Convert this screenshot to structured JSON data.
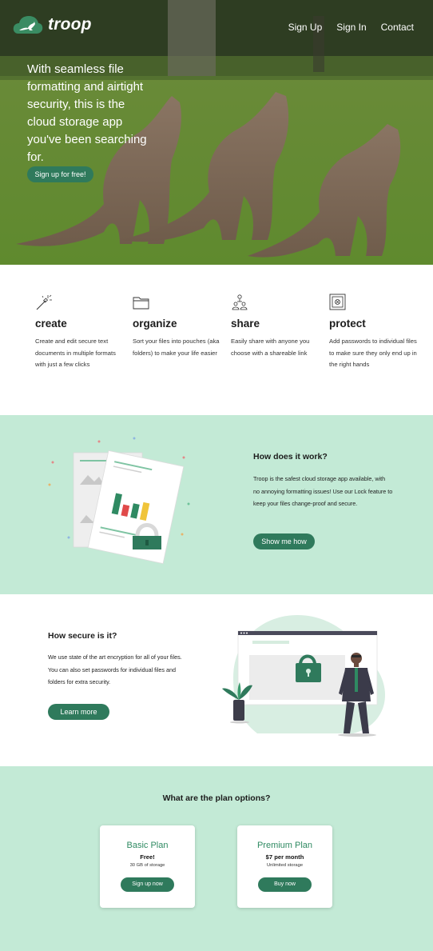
{
  "brand": {
    "name": "troop",
    "accent": "#2f7a5c",
    "mint": "#c3ead6"
  },
  "nav": [
    {
      "label": "Sign Up"
    },
    {
      "label": "Sign In"
    },
    {
      "label": "Contact"
    }
  ],
  "hero": {
    "headline": "With seamless file formatting and airtight security, this is the cloud storage app you've been searching for.",
    "cta": "Sign up for free!"
  },
  "features": [
    {
      "icon": "magic-wand-icon",
      "title": "create",
      "text": "Create and edit secure text documents in multiple formats with just a few clicks"
    },
    {
      "icon": "folder-icon",
      "title": "organize",
      "text": "Sort your files into pouches (aka folders) to make your life easier"
    },
    {
      "icon": "people-share-icon",
      "title": "share",
      "text": "Easily share with anyone you choose with a shareable link"
    },
    {
      "icon": "safe-icon",
      "title": "protect",
      "text": "Add passwords to individual files to make sure they only end up in the right hands"
    }
  ],
  "how": {
    "title": "How does it work?",
    "text": "Troop is the safest cloud storage app available, with no annoying formatting issues! Use our Lock feature to keep your files change-proof and secure.",
    "cta": "Show me how"
  },
  "secure": {
    "title": "How secure is it?",
    "text": "We use state of the art encryption for all of your files. You can also set passwords for individual files and folders for extra security.",
    "cta": "Learn more"
  },
  "plans": {
    "title": "What are the plan options?",
    "items": [
      {
        "name": "Basic Plan",
        "price": "Free!",
        "storage": "30 GB of storage",
        "cta": "Sign up now"
      },
      {
        "name": "Premium Plan",
        "price": "$7 per month",
        "storage": "Unlimited storage",
        "cta": "Buy now"
      }
    ]
  }
}
